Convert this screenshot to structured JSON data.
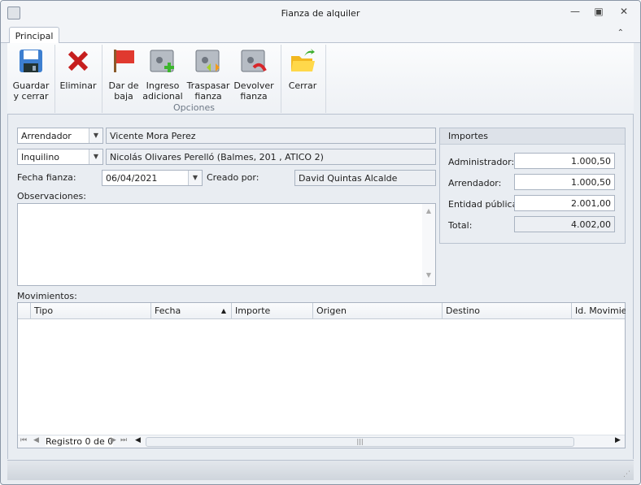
{
  "window": {
    "title": "Fianza de alquiler"
  },
  "tabs": [
    {
      "label": "Principal"
    }
  ],
  "ribbon": {
    "buttons": [
      {
        "label1": "Guardar",
        "label2": "y cerrar",
        "icon": "save-icon"
      },
      {
        "label1": "Eliminar",
        "label2": "",
        "icon": "delete-icon"
      },
      {
        "label1": "Dar de",
        "label2": "baja",
        "icon": "flag-icon"
      },
      {
        "label1": "Ingreso",
        "label2": "adicional",
        "icon": "safe-add-icon"
      },
      {
        "label1": "Traspasar",
        "label2": "fianza",
        "icon": "safe-transfer-icon"
      },
      {
        "label1": "Devolver",
        "label2": "fianza",
        "icon": "safe-return-icon"
      },
      {
        "label1": "Cerrar",
        "label2": "",
        "icon": "folder-close-icon"
      }
    ],
    "group_label": "Opciones"
  },
  "form": {
    "role1": "Arrendador",
    "name1": "Vicente Mora Perez",
    "role2": "Inquilino",
    "name2": "Nicolás Olivares Perelló (Balmes, 201 , ATICO 2)",
    "fecha_label": "Fecha fianza:",
    "fecha": "06/04/2021",
    "creado_label": "Creado por:",
    "creado": "David Quintas Alcalde",
    "obs_label": "Observaciones:",
    "obs": ""
  },
  "importes": {
    "title": "Importes",
    "rows": [
      {
        "label": "Administrador:",
        "value": "1.000,50"
      },
      {
        "label": "Arrendador:",
        "value": "1.000,50"
      },
      {
        "label": "Entidad pública:",
        "value": "2.001,00"
      },
      {
        "label": "Total:",
        "value": "4.002,00"
      }
    ]
  },
  "movimientos": {
    "label": "Movimientos:",
    "columns": [
      "Tipo",
      "Fecha",
      "Importe",
      "Origen",
      "Destino",
      "Id. Movimiento"
    ],
    "nav": "Registro 0 de 0"
  }
}
